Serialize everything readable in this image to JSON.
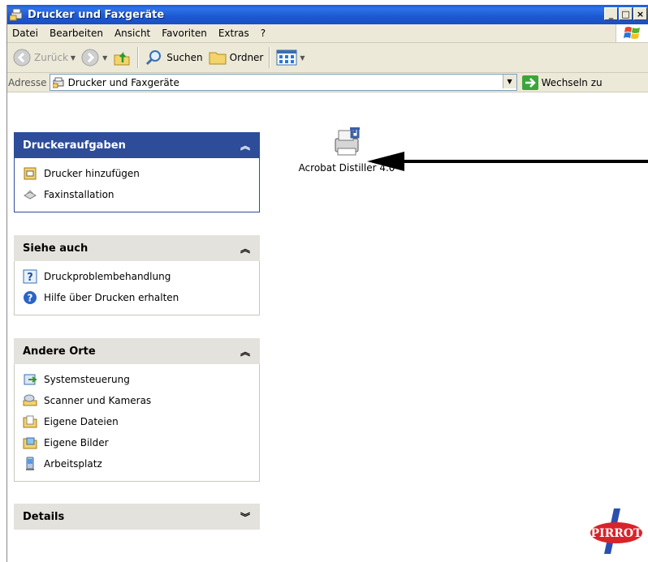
{
  "window": {
    "title": "Drucker und Faxgeräte"
  },
  "menu": [
    "Datei",
    "Bearbeiten",
    "Ansicht",
    "Favoriten",
    "Extras",
    "?"
  ],
  "toolbar": {
    "back": "Zurück",
    "search": "Suchen",
    "folders": "Ordner"
  },
  "address": {
    "label": "Adresse",
    "value": "Drucker und Faxgeräte",
    "go": "Wechseln zu"
  },
  "panels": {
    "printer_tasks": {
      "title": "Druckeraufgaben",
      "items": [
        "Drucker hinzufügen",
        "Faxinstallation"
      ]
    },
    "see_also": {
      "title": "Siehe auch",
      "items": [
        "Druckproblembehandlung",
        "Hilfe über Drucken erhalten"
      ]
    },
    "other_places": {
      "title": "Andere Orte",
      "items": [
        "Systemsteuerung",
        "Scanner und Kameras",
        "Eigene Dateien",
        "Eigene Bilder",
        "Arbeitsplatz"
      ]
    },
    "details": {
      "title": "Details"
    }
  },
  "printers": [
    {
      "name": "Acrobat Distiller 4.0"
    }
  ],
  "watermark": "PIRROT",
  "colors": {
    "titlebar": "#1c58d2",
    "task_header": "#2d4c9a"
  }
}
